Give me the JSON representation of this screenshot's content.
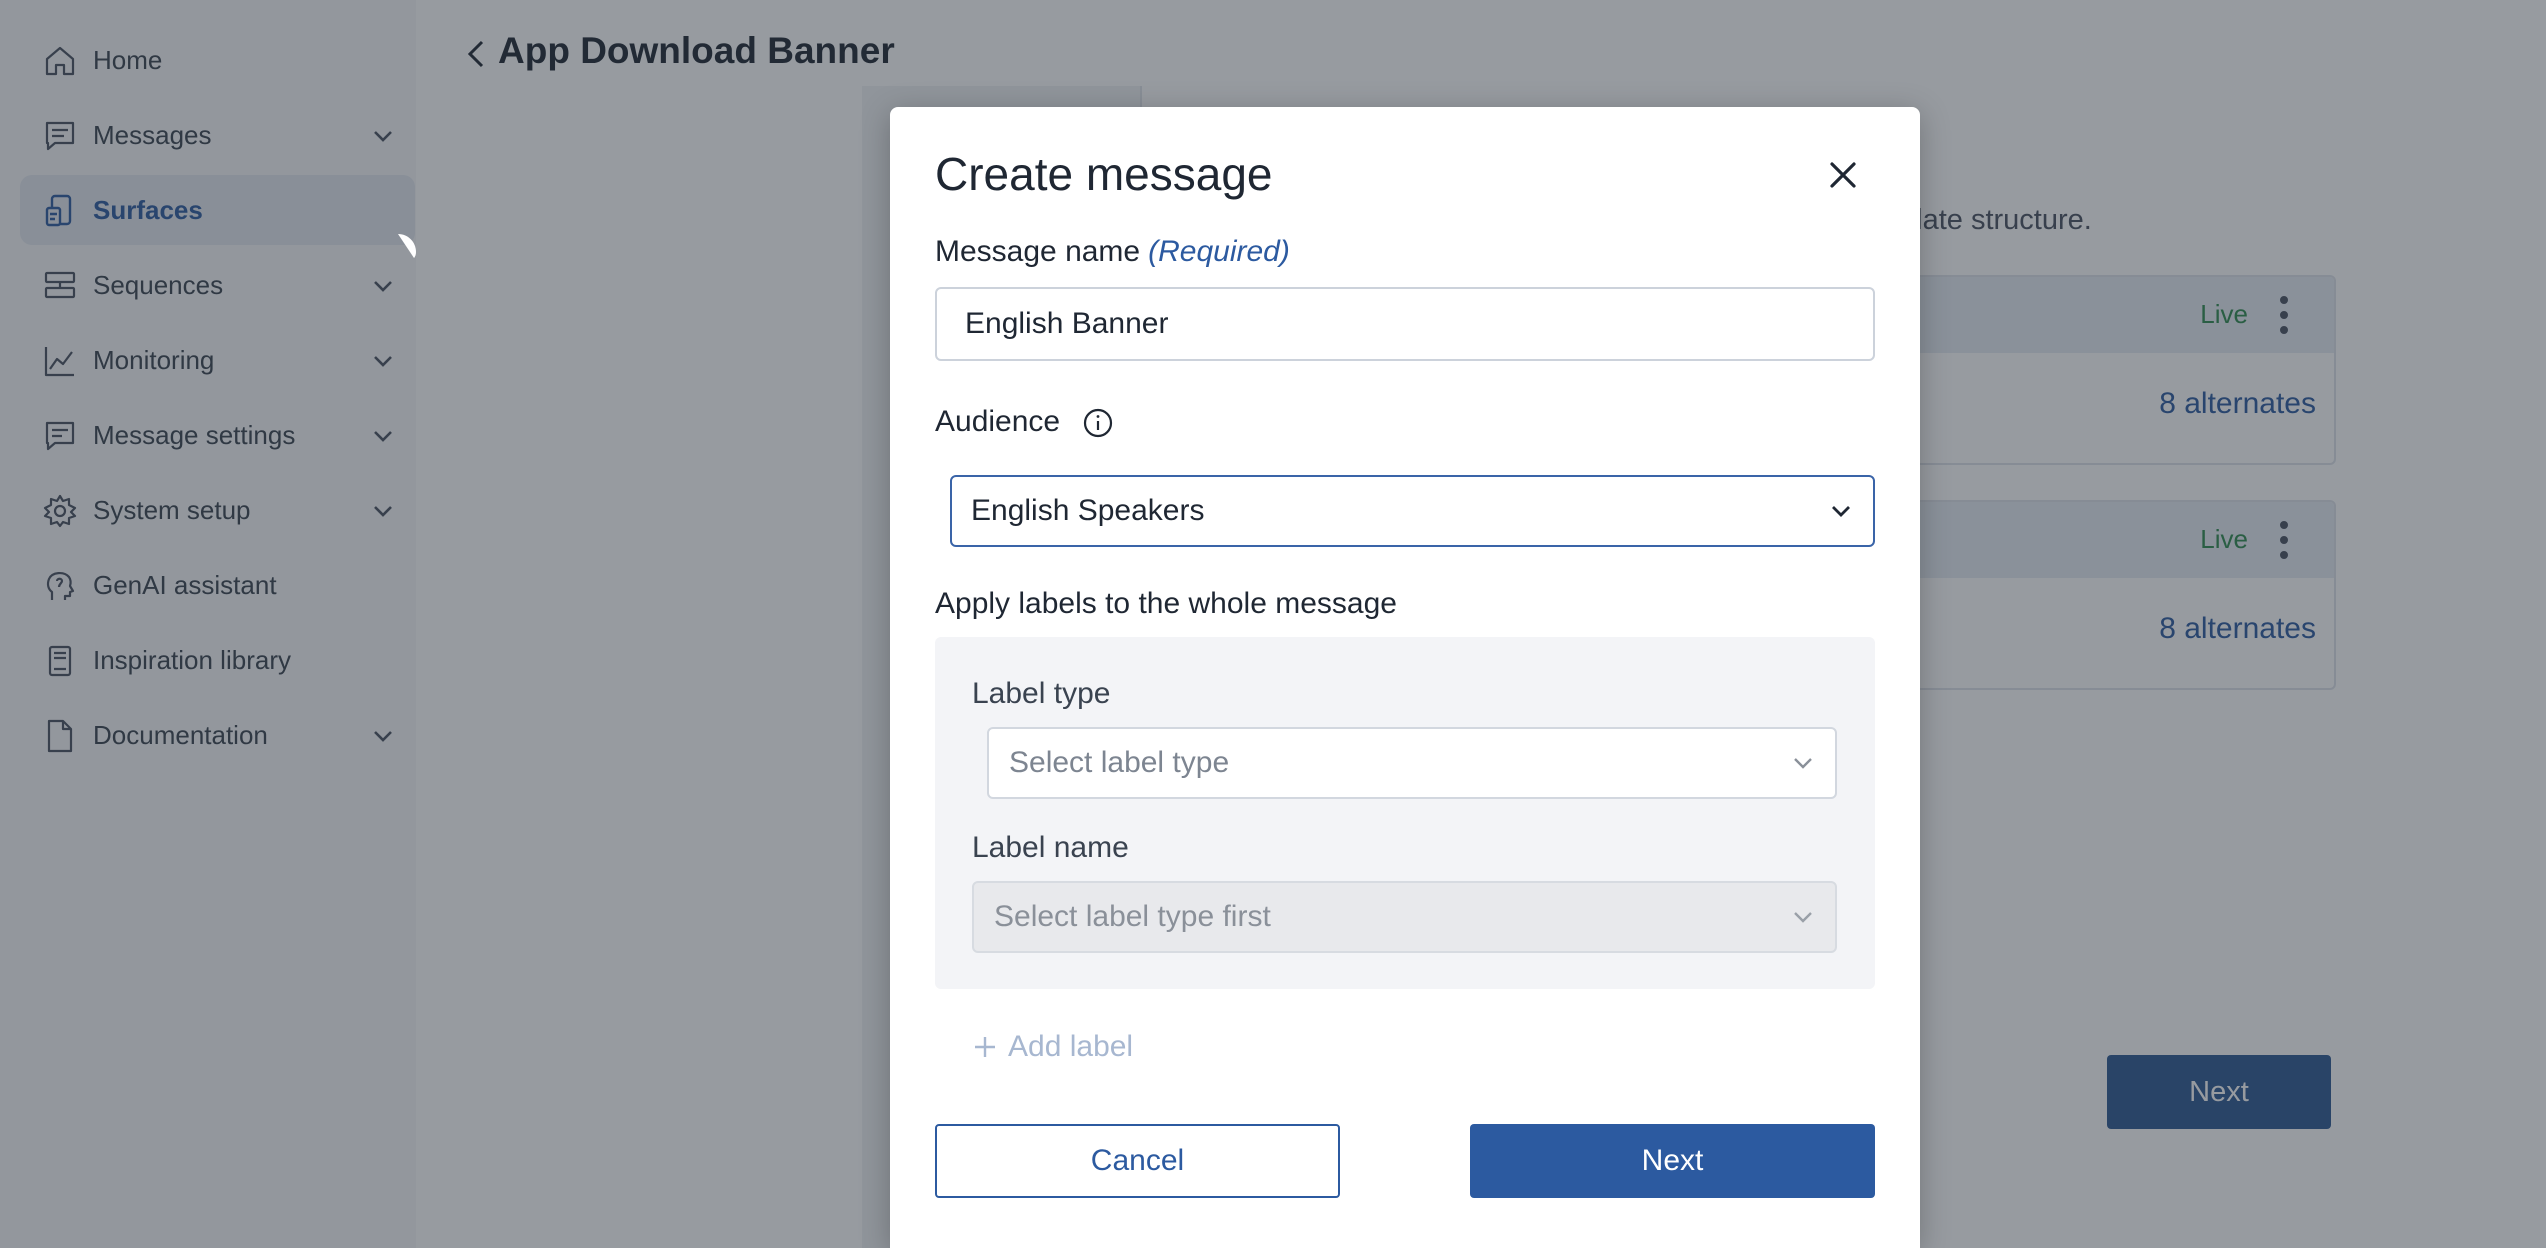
{
  "sidebar": {
    "items": [
      {
        "label": "Home",
        "icon": "home-icon",
        "expandable": false,
        "active": false
      },
      {
        "label": "Messages",
        "icon": "message-icon",
        "expandable": true,
        "active": false
      },
      {
        "label": "Surfaces",
        "icon": "device-icon",
        "expandable": false,
        "active": true
      },
      {
        "label": "Sequences",
        "icon": "sequence-icon",
        "expandable": true,
        "active": false
      },
      {
        "label": "Monitoring",
        "icon": "chart-line-icon",
        "expandable": true,
        "active": false
      },
      {
        "label": "Message settings",
        "icon": "message-settings-icon",
        "expandable": true,
        "active": false
      },
      {
        "label": "System setup",
        "icon": "gear-icon",
        "expandable": true,
        "active": false
      },
      {
        "label": "GenAI assistant",
        "icon": "genai-head-icon",
        "expandable": false,
        "active": false
      },
      {
        "label": "Inspiration library",
        "icon": "book-icon",
        "expandable": false,
        "active": false
      },
      {
        "label": "Documentation",
        "icon": "document-icon",
        "expandable": true,
        "active": false
      }
    ]
  },
  "page": {
    "title": "App Download Banner",
    "description_fragment": "plate structure.",
    "cards": [
      {
        "status": "Live",
        "alternates": "8 alternates"
      },
      {
        "status": "Live",
        "alternates": "8 alternates"
      }
    ],
    "next_label": "Next"
  },
  "modal": {
    "title": "Create message",
    "message_name": {
      "label": "Message name",
      "required_text": "(Required)",
      "value": "English Banner"
    },
    "audience": {
      "label": "Audience",
      "selected": "English Speakers"
    },
    "labels_section": {
      "heading": "Apply labels to the whole message",
      "label_type": {
        "label": "Label type",
        "placeholder": "Select label type"
      },
      "label_name": {
        "label": "Label name",
        "placeholder": "Select label type first"
      },
      "add_label": "Add label"
    },
    "cancel_label": "Cancel",
    "next_label": "Next"
  },
  "colors": {
    "accent": "#2c5aa0",
    "live": "#2f8a4f",
    "overlay": "rgba(38,46,56,0.48)"
  }
}
